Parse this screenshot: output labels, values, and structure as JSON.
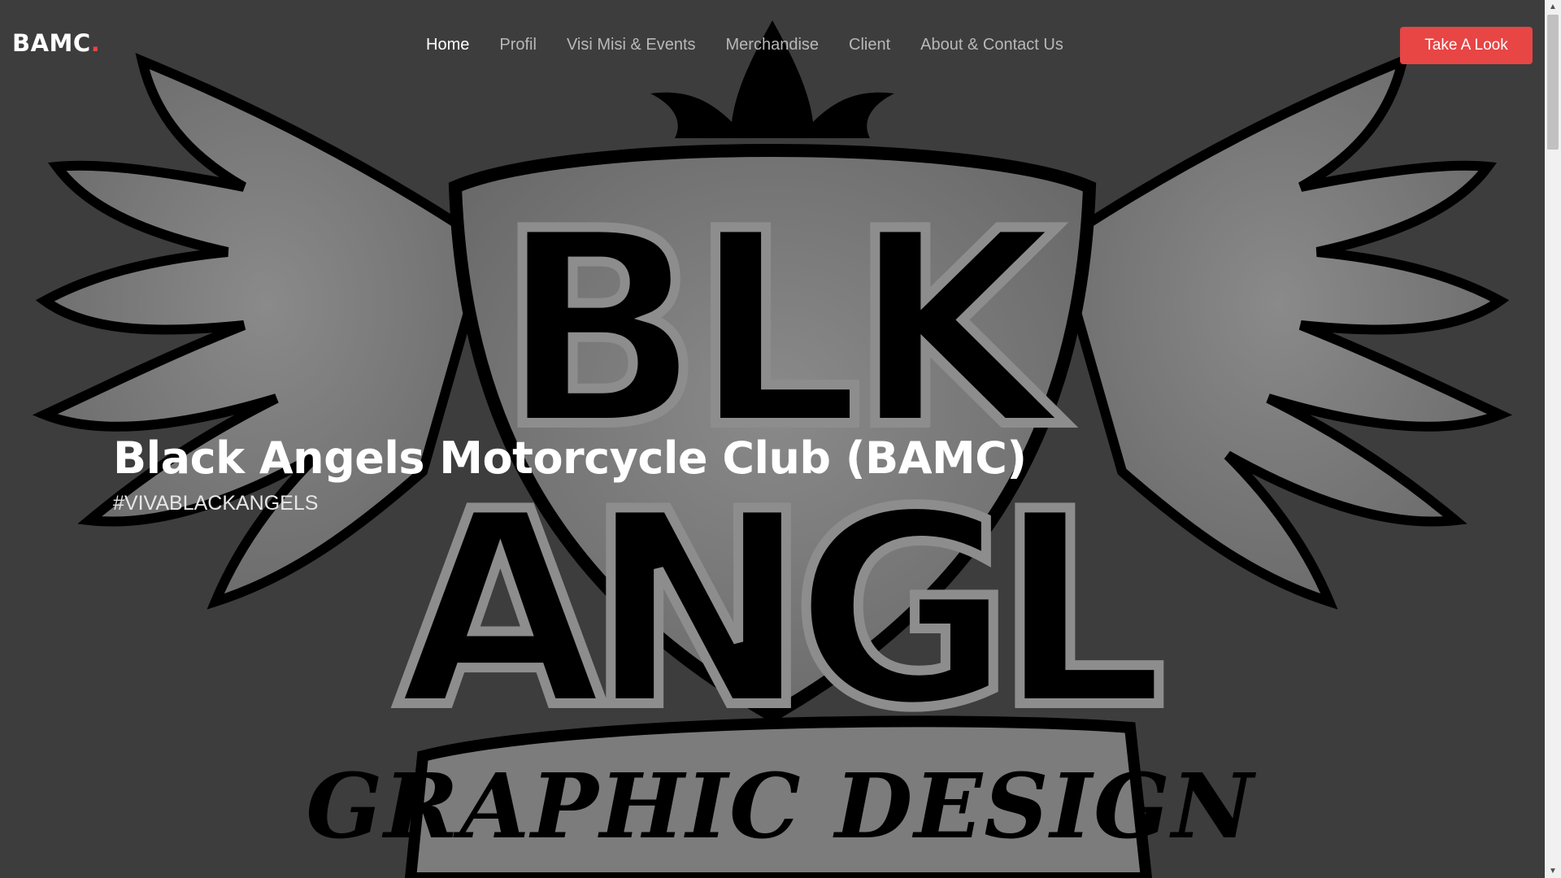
{
  "brand": {
    "name": "BAMC",
    "dot": "."
  },
  "nav": {
    "items": [
      {
        "label": "Home",
        "active": true
      },
      {
        "label": "Profil"
      },
      {
        "label": "Visi Misi & Events"
      },
      {
        "label": "Merchandise"
      },
      {
        "label": "Client"
      },
      {
        "label": "About & Contact Us"
      }
    ],
    "cta_label": "Take A Look"
  },
  "hero": {
    "title": "Black Angels Motorcycle Club (BAMC)",
    "subtitle": "#VIVABLACKANGELS",
    "background_logo_text": [
      "BLK",
      "ANGL",
      "GRAPHIC DESIGN"
    ]
  },
  "colors": {
    "accent": "#e84545",
    "background": "#3d3d3d",
    "nav_inactive": "#b8b8b8",
    "text_primary": "#ffffff"
  },
  "icons": [
    "winged-shield-logo",
    "scroll-up-arrow",
    "scroll-down-arrow"
  ]
}
